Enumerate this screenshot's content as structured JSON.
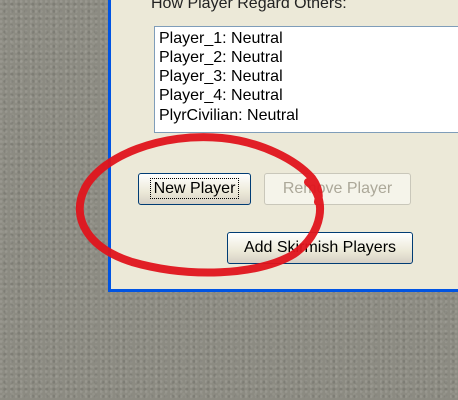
{
  "dialog": {
    "group_label": "How Player Regard Others:",
    "list_items": [
      "Player_1: Neutral",
      "Player_2: Neutral",
      "Player_3: Neutral",
      "Player_4: Neutral",
      "PlyrCivilian: Neutral"
    ],
    "buttons": {
      "new_player": "New Player",
      "remove_player": "Remove Player",
      "add_skirmish_players": "Add Skirmish Players"
    }
  },
  "colors": {
    "annotation_circle": "#e0141c",
    "dialog_border": "#0054e3",
    "dialog_background": "#ece9d8",
    "desktop_background": "#8c8b82"
  }
}
